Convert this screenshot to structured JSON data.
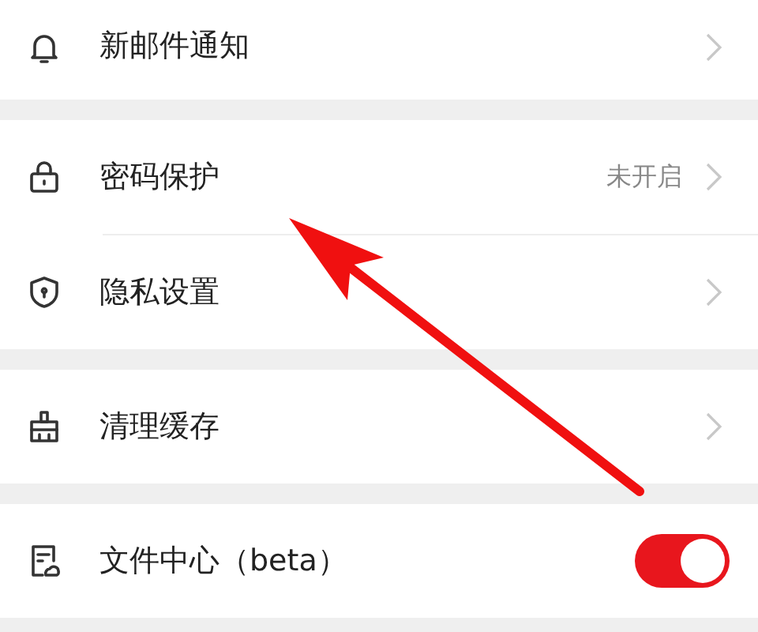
{
  "groups": [
    {
      "items": [
        {
          "kind": "link",
          "label": "新邮件通知"
        }
      ]
    },
    {
      "items": [
        {
          "kind": "link",
          "label": "密码保护",
          "value": "未开启"
        },
        {
          "kind": "link",
          "label": "隐私设置"
        }
      ]
    },
    {
      "items": [
        {
          "kind": "link",
          "label": "清理缓存"
        }
      ]
    },
    {
      "items": [
        {
          "kind": "toggle",
          "label": "文件中心（beta）",
          "on": true
        }
      ]
    }
  ],
  "annotation": {
    "kind": "arrow"
  }
}
